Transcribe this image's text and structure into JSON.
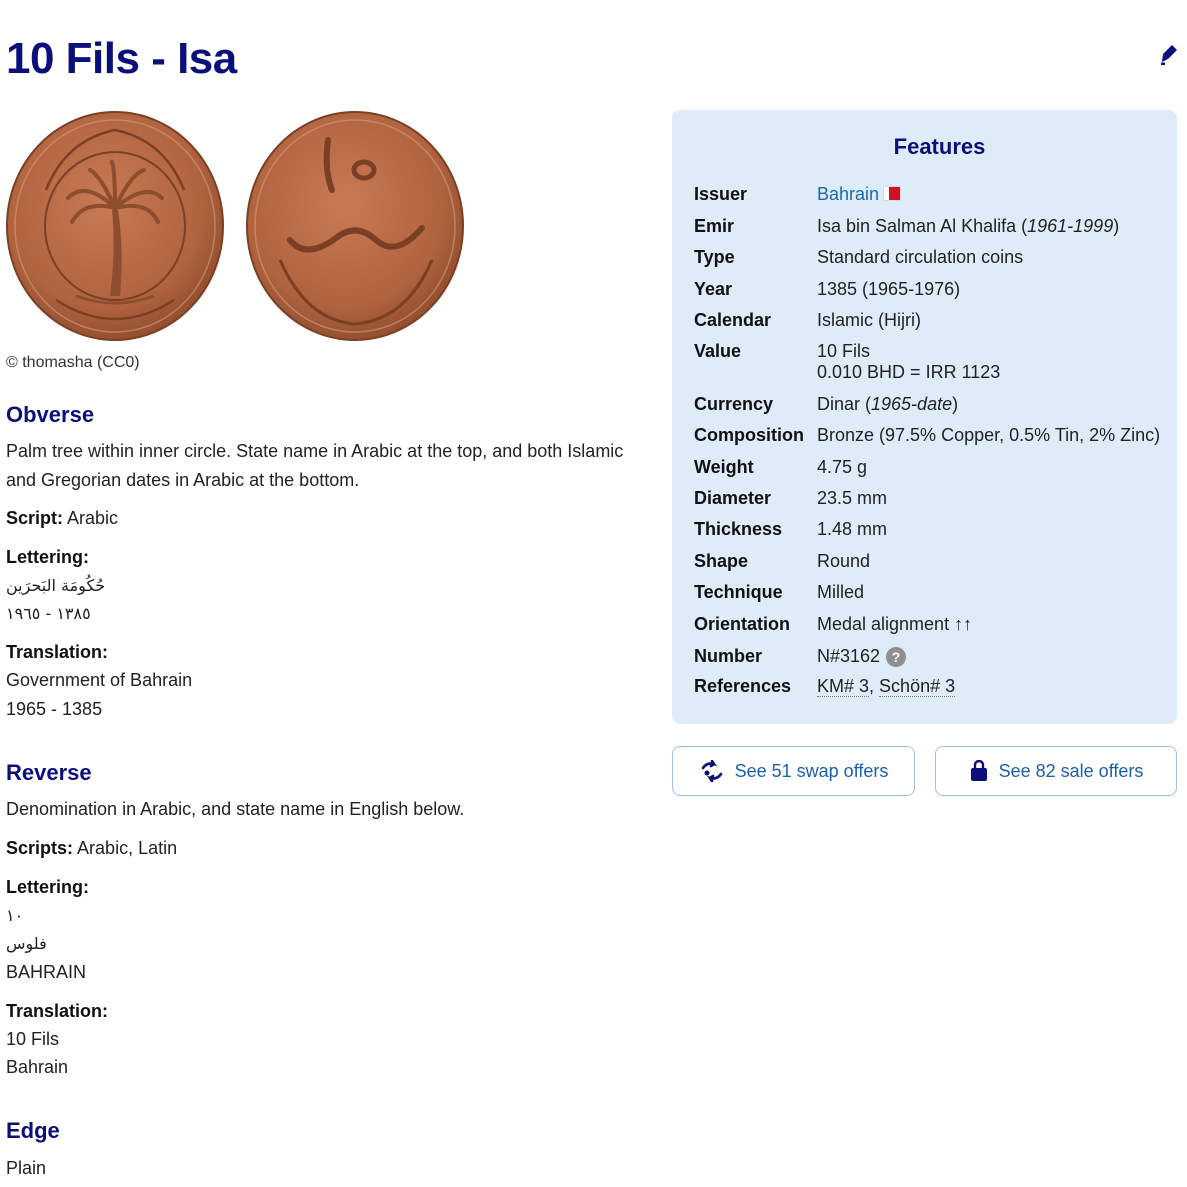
{
  "page": {
    "title": "10 Fils - Isa"
  },
  "icons": {
    "edit": "pencil-icon",
    "swap": "swap-icon",
    "sale": "shopping-bag-icon",
    "help": "question-icon",
    "flag": "bahrain-flag-icon"
  },
  "images": {
    "credit": "© thomasha (CC0)"
  },
  "obverse": {
    "heading": "Obverse",
    "description": "Palm tree within inner circle. State name in Arabic at the top, and both Islamic and Gregorian dates in Arabic at the bottom.",
    "script_label": "Script:",
    "script_value": "Arabic",
    "lettering_label": "Lettering:",
    "lettering_line1": "حُكُومَة البَحرَين",
    "lettering_line2": "١٣٨٥ - ١٩٦٥",
    "translation_label": "Translation:",
    "translation_line1": "Government of Bahrain",
    "translation_line2": "1965 - 1385"
  },
  "reverse": {
    "heading": "Reverse",
    "description": "Denomination in Arabic, and state name in English below.",
    "scripts_label": "Scripts:",
    "scripts_value": "Arabic, Latin",
    "lettering_label": "Lettering:",
    "lettering_line1": "١٠",
    "lettering_line2": "فلوس",
    "lettering_line3": "BAHRAIN",
    "translation_label": "Translation:",
    "translation_line1": "10 Fils",
    "translation_line2": "Bahrain"
  },
  "edge": {
    "heading": "Edge",
    "value": "Plain"
  },
  "features": {
    "heading": "Features",
    "issuer_label": "Issuer",
    "issuer_value": "Bahrain",
    "emir_label": "Emir",
    "emir_value": "Isa bin Salman Al Khalifa (",
    "emir_years": "1961-1999",
    "emir_close": ")",
    "type_label": "Type",
    "type_value": "Standard circulation coins",
    "year_label": "Year",
    "year_value": "1385 (1965-1976)",
    "calendar_label": "Calendar",
    "calendar_value": "Islamic (Hijri)",
    "value_label": "Value",
    "value_line1": "10 Fils",
    "value_line2": "0.010 BHD = IRR 1123",
    "currency_label": "Currency",
    "currency_value": "Dinar (",
    "currency_years": "1965-date",
    "currency_close": ")",
    "composition_label": "Composition",
    "composition_value": "Bronze (97.5% Copper, 0.5% Tin, 2% Zinc)",
    "weight_label": "Weight",
    "weight_value": "4.75 g",
    "diameter_label": "Diameter",
    "diameter_value": "23.5 mm",
    "thickness_label": "Thickness",
    "thickness_value": "1.48 mm",
    "shape_label": "Shape",
    "shape_value": "Round",
    "technique_label": "Technique",
    "technique_value": "Milled",
    "orientation_label": "Orientation",
    "orientation_value": "Medal alignment ↑↑",
    "number_label": "Number",
    "number_value": "N#3162",
    "help_symbol": "?",
    "references_label": "References",
    "references_km": "KM# 3",
    "references_sep": ", ",
    "references_schon": "Schön# 3"
  },
  "buttons": {
    "swap": "See 51 swap offers",
    "sale": "See 82 sale offers"
  },
  "colors": {
    "heading": "#0b0f7a",
    "link": "#1a6aa8",
    "panel": "#deecf9",
    "button_border": "#9ec2e6",
    "coin": "#b0633f"
  }
}
